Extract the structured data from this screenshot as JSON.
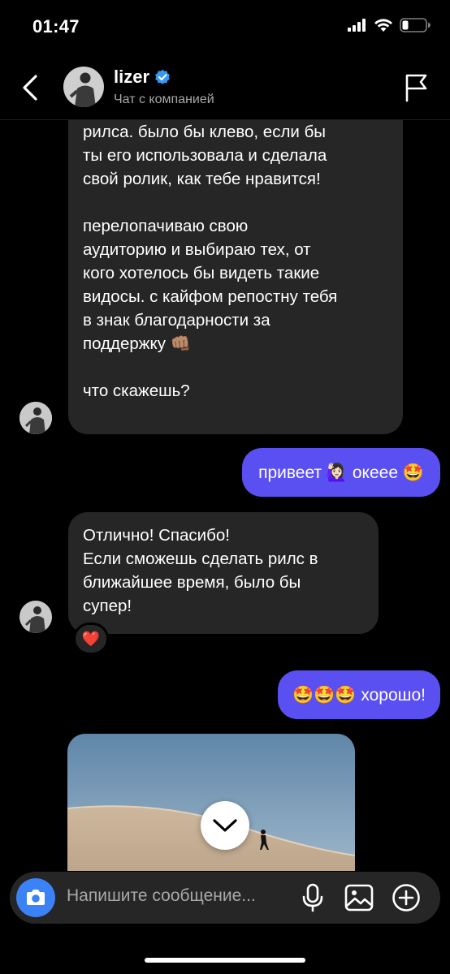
{
  "status": {
    "time": "01:47"
  },
  "header": {
    "name": "lizer",
    "subtitle": "Чат с компанией"
  },
  "messages": {
    "m1_lines": [
      "рилса. было бы клево, если бы",
      "ты его использовала и сделала",
      "свой ролик, как тебе нравится!",
      "",
      "перелопачиваю свою",
      "аудиторию и выбираю тех, от",
      "кого хотелось бы видеть такие",
      "видосы. с кайфом репостну тебя",
      "в знак благодарности за",
      "поддержку 👊🏽",
      "",
      "что скажешь?"
    ],
    "m2": "привеет 🙋🏻‍♀️ океее 🤩",
    "m3_lines": [
      "Отлично! Спасибо!",
      "Если сможешь сделать рилс в",
      "ближайшее время, было бы",
      "супер!"
    ],
    "m3_reaction": "❤️",
    "m4": "🤩🤩🤩 хорошо!"
  },
  "composer": {
    "placeholder": "Напишите сообщение..."
  },
  "colors": {
    "outgoing_bubble": "#5a4ff0",
    "incoming_bubble": "#262626",
    "camera_button": "#3b82f6",
    "verified_badge": "#3897f0"
  },
  "icons": [
    "back-chevron-icon",
    "verified-badge-icon",
    "flag-icon",
    "camera-icon",
    "microphone-icon",
    "gallery-icon",
    "plus-circle-icon",
    "chevron-down-icon"
  ]
}
